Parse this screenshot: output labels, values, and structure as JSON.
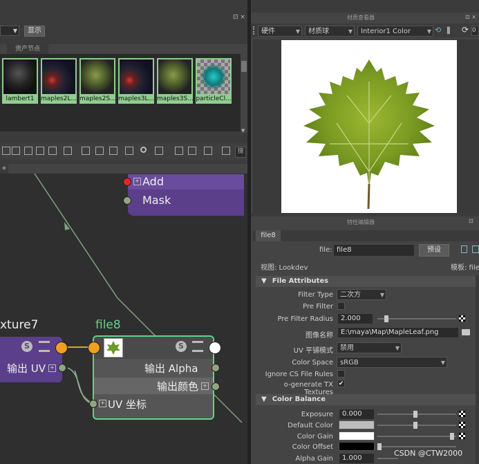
{
  "left_top": {
    "display_button": "显示",
    "asset_tab": "资产节点"
  },
  "swatches": [
    {
      "label": "lambert1",
      "icon": "sphere-dark"
    },
    {
      "label": "maples2L...",
      "icon": "sphere-red"
    },
    {
      "label": "maples2S...",
      "icon": "sphere-green"
    },
    {
      "label": "maples3L...",
      "icon": "sphere-red"
    },
    {
      "label": "maples3S...",
      "icon": "sphere-green"
    },
    {
      "label": "particleCl...",
      "icon": "checker-cyan"
    }
  ],
  "node_editor": {
    "search_stub": "搜",
    "add_node": {
      "ports": [
        "Add",
        "Mask"
      ]
    },
    "texture_node": {
      "title": "xture7",
      "output_uv": "输出 UV"
    },
    "file_node": {
      "title": "file8",
      "output_alpha": "输出 Alpha",
      "output_color": "输出颜色",
      "uv_coord": "UV 坐标"
    },
    "colors": {
      "accent": "#5fd48a",
      "purple": "#5b3f8a",
      "port_orange": "#f0a020"
    }
  },
  "material_viewer": {
    "title": "材质查看器",
    "renderer": "硬件",
    "shape": "材质球",
    "material": "Interior1 Color",
    "zoom_stub": "0"
  },
  "attribute_editor": {
    "title": "特性编辑器",
    "tab": "file8",
    "file_label": "file:",
    "file_value": "file8",
    "preset_button": "预设",
    "view_label": "视图: Lookdev",
    "template_label": "模板: file",
    "sections": {
      "file_attributes": "File Attributes",
      "color_balance": "Color Balance"
    },
    "rows": {
      "filter_type": {
        "label": "Filter Type",
        "value": "二次方"
      },
      "pre_filter": {
        "label": "Pre Filter"
      },
      "pre_filter_radius": {
        "label": "Pre Filter Radius",
        "value": "2.000"
      },
      "image_name": {
        "label": "图像名称",
        "value": "E:\\maya\\Map\\MapleLeaf.png"
      },
      "uv_tiling": {
        "label": "UV 平铺模式",
        "value": "禁用"
      },
      "color_space": {
        "label": "Color Space",
        "value": "sRGB"
      },
      "ignore_cs": {
        "label": "Ignore CS File Rules"
      },
      "gen_tx": {
        "label": "o-generate TX Textures"
      },
      "exposure": {
        "label": "Exposure",
        "value": "0.000"
      },
      "default_color": {
        "label": "Default Color"
      },
      "color_gain": {
        "label": "Color Gain"
      },
      "color_offset": {
        "label": "Color Offset"
      },
      "alpha_gain": {
        "label": "Alpha Gain",
        "value": "1.000"
      }
    }
  },
  "watermark": "CSDN @CTW2000"
}
